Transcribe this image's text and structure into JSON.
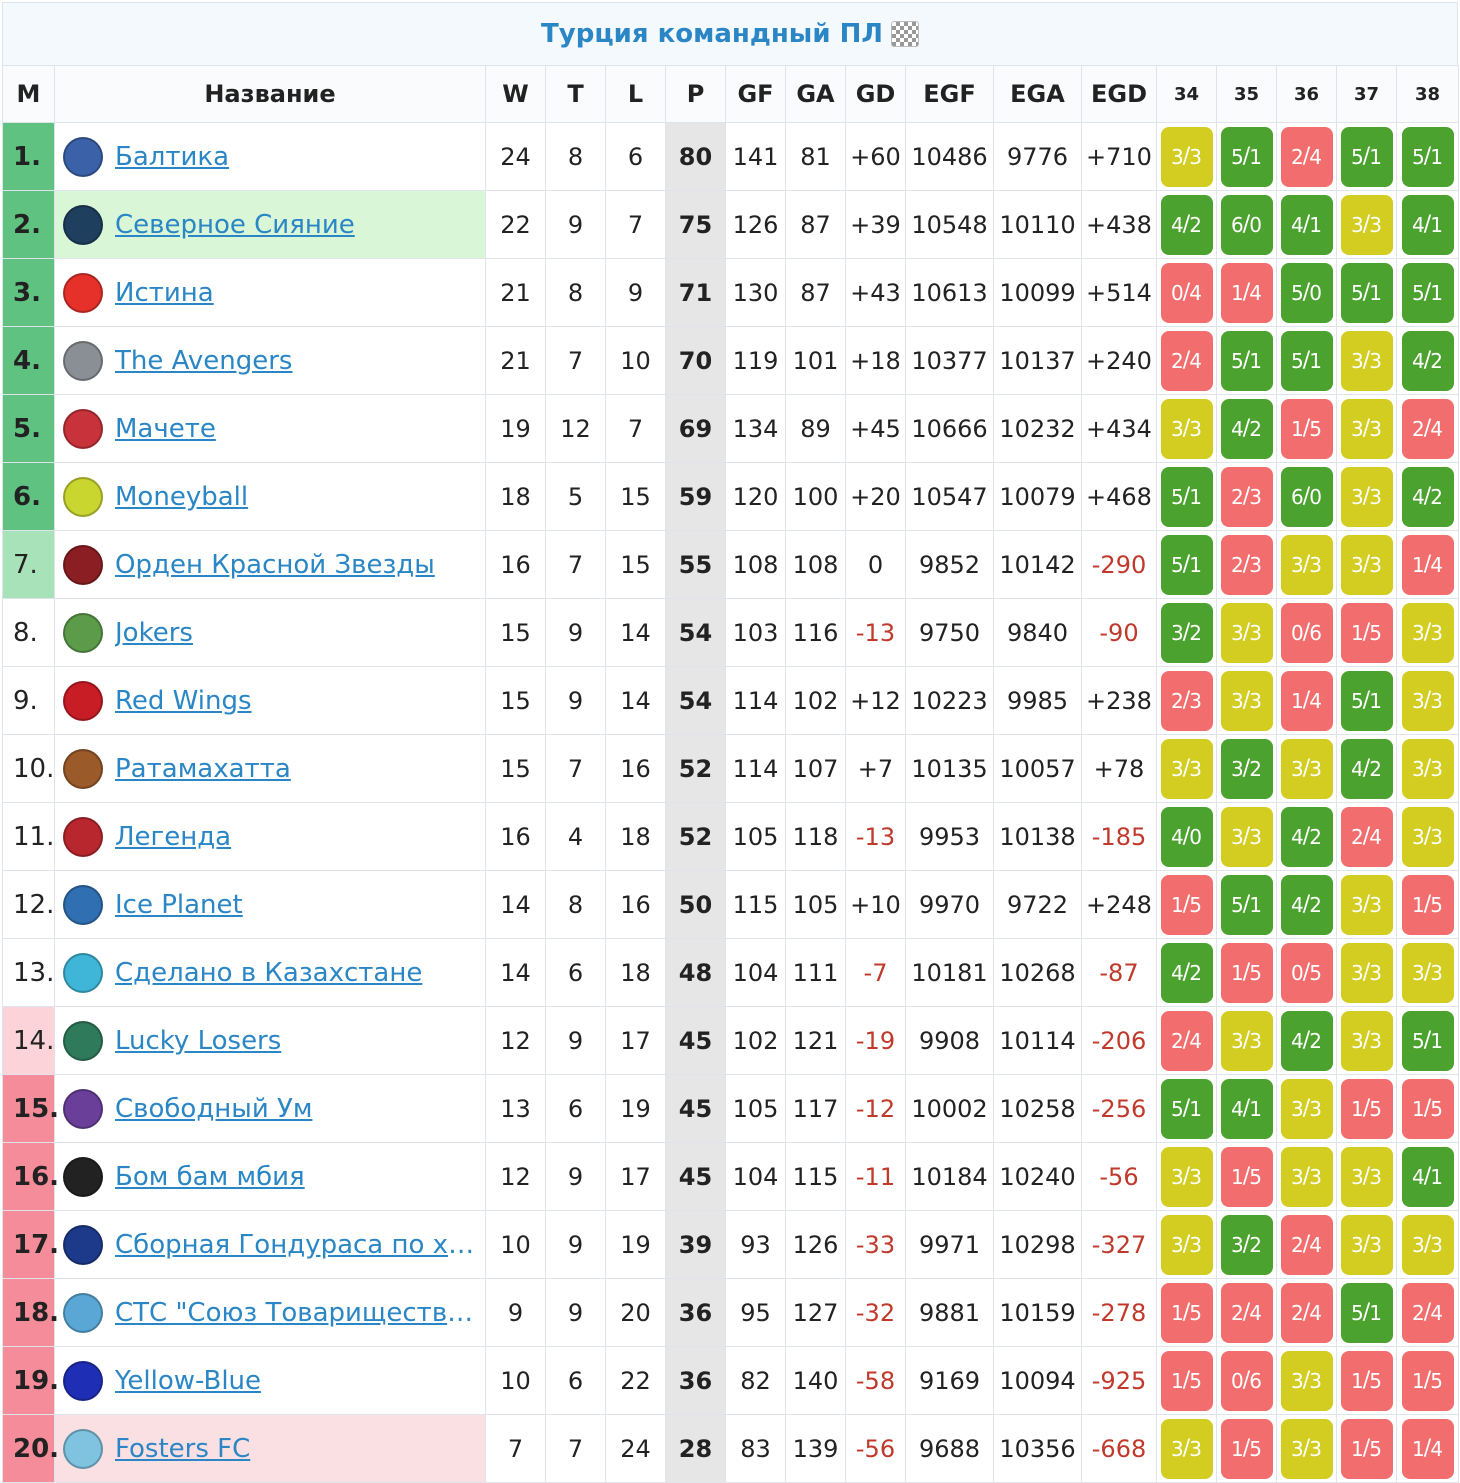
{
  "title": "Турция командный ПЛ",
  "headers": {
    "pos": "М",
    "name": "Название",
    "w": "W",
    "t": "T",
    "l": "L",
    "p": "P",
    "gf": "GF",
    "ga": "GA",
    "gd": "GD",
    "egf": "EGF",
    "ega": "EGA",
    "egd": "EGD",
    "rounds": [
      "34",
      "35",
      "36",
      "37",
      "38"
    ]
  },
  "rows": [
    {
      "pos": "1.",
      "name": "Балтика",
      "w": "24",
      "t": "8",
      "l": "6",
      "p": "80",
      "gf": "141",
      "ga": "81",
      "gd": "+60",
      "egf": "10486",
      "ega": "9776",
      "egd": "+710",
      "logo_color": "#3b62a8",
      "results": [
        [
          "3",
          "3"
        ],
        [
          "5",
          "1"
        ],
        [
          "2",
          "4"
        ],
        [
          "5",
          "1"
        ],
        [
          "5",
          "1"
        ]
      ]
    },
    {
      "pos": "2.",
      "name": "Северное Сияние",
      "w": "22",
      "t": "9",
      "l": "7",
      "p": "75",
      "gf": "126",
      "ga": "87",
      "gd": "+39",
      "egf": "10548",
      "ega": "10110",
      "egd": "+438",
      "logo_color": "#1f3f5e",
      "results": [
        [
          "4",
          "2"
        ],
        [
          "6",
          "0"
        ],
        [
          "4",
          "1"
        ],
        [
          "3",
          "3"
        ],
        [
          "4",
          "1"
        ]
      ]
    },
    {
      "pos": "3.",
      "name": "Истина",
      "w": "21",
      "t": "8",
      "l": "9",
      "p": "71",
      "gf": "130",
      "ga": "87",
      "gd": "+43",
      "egf": "10613",
      "ega": "10099",
      "egd": "+514",
      "logo_color": "#e5312a",
      "results": [
        [
          "0",
          "4"
        ],
        [
          "1",
          "4"
        ],
        [
          "5",
          "0"
        ],
        [
          "5",
          "1"
        ],
        [
          "5",
          "1"
        ]
      ]
    },
    {
      "pos": "4.",
      "name": "The Avengers",
      "w": "21",
      "t": "7",
      "l": "10",
      "p": "70",
      "gf": "119",
      "ga": "101",
      "gd": "+18",
      "egf": "10377",
      "ega": "10137",
      "egd": "+240",
      "logo_color": "#8a8f96",
      "results": [
        [
          "2",
          "4"
        ],
        [
          "5",
          "1"
        ],
        [
          "5",
          "1"
        ],
        [
          "3",
          "3"
        ],
        [
          "4",
          "2"
        ]
      ]
    },
    {
      "pos": "5.",
      "name": "Мачете",
      "w": "19",
      "t": "12",
      "l": "7",
      "p": "69",
      "gf": "134",
      "ga": "89",
      "gd": "+45",
      "egf": "10666",
      "ega": "10232",
      "egd": "+434",
      "logo_color": "#c8323a",
      "results": [
        [
          "3",
          "3"
        ],
        [
          "4",
          "2"
        ],
        [
          "1",
          "5"
        ],
        [
          "3",
          "3"
        ],
        [
          "2",
          "4"
        ]
      ]
    },
    {
      "pos": "6.",
      "name": "Moneyball",
      "w": "18",
      "t": "5",
      "l": "15",
      "p": "59",
      "gf": "120",
      "ga": "100",
      "gd": "+20",
      "egf": "10547",
      "ega": "10079",
      "egd": "+468",
      "logo_color": "#c9d630",
      "results": [
        [
          "5",
          "1"
        ],
        [
          "2",
          "3"
        ],
        [
          "6",
          "0"
        ],
        [
          "3",
          "3"
        ],
        [
          "4",
          "2"
        ]
      ]
    },
    {
      "pos": "7.",
      "name": "Орден Красной Звезды",
      "w": "16",
      "t": "7",
      "l": "15",
      "p": "55",
      "gf": "108",
      "ga": "108",
      "gd": "0",
      "egf": "9852",
      "ega": "10142",
      "egd": "-290",
      "logo_color": "#8b1e22",
      "results": [
        [
          "5",
          "1"
        ],
        [
          "2",
          "3"
        ],
        [
          "3",
          "3"
        ],
        [
          "3",
          "3"
        ],
        [
          "1",
          "4"
        ]
      ]
    },
    {
      "pos": "8.",
      "name": "Jokers",
      "w": "15",
      "t": "9",
      "l": "14",
      "p": "54",
      "gf": "103",
      "ga": "116",
      "gd": "-13",
      "egf": "9750",
      "ega": "9840",
      "egd": "-90",
      "logo_color": "#5b9b4a",
      "results": [
        [
          "3",
          "2"
        ],
        [
          "3",
          "3"
        ],
        [
          "0",
          "6"
        ],
        [
          "1",
          "5"
        ],
        [
          "3",
          "3"
        ]
      ]
    },
    {
      "pos": "9.",
      "name": "Red Wings",
      "w": "15",
      "t": "9",
      "l": "14",
      "p": "54",
      "gf": "114",
      "ga": "102",
      "gd": "+12",
      "egf": "10223",
      "ega": "9985",
      "egd": "+238",
      "logo_color": "#c81d25",
      "results": [
        [
          "2",
          "3"
        ],
        [
          "3",
          "3"
        ],
        [
          "1",
          "4"
        ],
        [
          "5",
          "1"
        ],
        [
          "3",
          "3"
        ]
      ]
    },
    {
      "pos": "10.",
      "name": "Ратамахатта",
      "w": "15",
      "t": "7",
      "l": "16",
      "p": "52",
      "gf": "114",
      "ga": "107",
      "gd": "+7",
      "egf": "10135",
      "ega": "10057",
      "egd": "+78",
      "logo_color": "#9a5a2a",
      "results": [
        [
          "3",
          "3"
        ],
        [
          "3",
          "2"
        ],
        [
          "3",
          "3"
        ],
        [
          "4",
          "2"
        ],
        [
          "3",
          "3"
        ]
      ]
    },
    {
      "pos": "11.",
      "name": "Легенда",
      "w": "16",
      "t": "4",
      "l": "18",
      "p": "52",
      "gf": "105",
      "ga": "118",
      "gd": "-13",
      "egf": "9953",
      "ega": "10138",
      "egd": "-185",
      "logo_color": "#b8272d",
      "results": [
        [
          "4",
          "0"
        ],
        [
          "3",
          "3"
        ],
        [
          "4",
          "2"
        ],
        [
          "2",
          "4"
        ],
        [
          "3",
          "3"
        ]
      ]
    },
    {
      "pos": "12.",
      "name": "Ice Planet",
      "w": "14",
      "t": "8",
      "l": "16",
      "p": "50",
      "gf": "115",
      "ga": "105",
      "gd": "+10",
      "egf": "9970",
      "ega": "9722",
      "egd": "+248",
      "logo_color": "#2f6fb2",
      "results": [
        [
          "1",
          "5"
        ],
        [
          "5",
          "1"
        ],
        [
          "4",
          "2"
        ],
        [
          "3",
          "3"
        ],
        [
          "1",
          "5"
        ]
      ]
    },
    {
      "pos": "13.",
      "name": "Сделано в Казахстане",
      "w": "14",
      "t": "6",
      "l": "18",
      "p": "48",
      "gf": "104",
      "ga": "111",
      "gd": "-7",
      "egf": "10181",
      "ega": "10268",
      "egd": "-87",
      "logo_color": "#3fb6d8",
      "results": [
        [
          "4",
          "2"
        ],
        [
          "1",
          "5"
        ],
        [
          "0",
          "5"
        ],
        [
          "3",
          "3"
        ],
        [
          "3",
          "3"
        ]
      ]
    },
    {
      "pos": "14.",
      "name": "Lucky Losers",
      "w": "12",
      "t": "9",
      "l": "17",
      "p": "45",
      "gf": "102",
      "ga": "121",
      "gd": "-19",
      "egf": "9908",
      "ega": "10114",
      "egd": "-206",
      "logo_color": "#2f7a5a",
      "results": [
        [
          "2",
          "4"
        ],
        [
          "3",
          "3"
        ],
        [
          "4",
          "2"
        ],
        [
          "3",
          "3"
        ],
        [
          "5",
          "1"
        ]
      ]
    },
    {
      "pos": "15.",
      "name": "Свободный Ум",
      "w": "13",
      "t": "6",
      "l": "19",
      "p": "45",
      "gf": "105",
      "ga": "117",
      "gd": "-12",
      "egf": "10002",
      "ega": "10258",
      "egd": "-256",
      "logo_color": "#6a3f9a",
      "results": [
        [
          "5",
          "1"
        ],
        [
          "4",
          "1"
        ],
        [
          "3",
          "3"
        ],
        [
          "1",
          "5"
        ],
        [
          "1",
          "5"
        ]
      ]
    },
    {
      "pos": "16.",
      "name": "Бом бам мбия",
      "w": "12",
      "t": "9",
      "l": "17",
      "p": "45",
      "gf": "104",
      "ga": "115",
      "gd": "-11",
      "egf": "10184",
      "ega": "10240",
      "egd": "-56",
      "logo_color": "#222222",
      "results": [
        [
          "3",
          "3"
        ],
        [
          "1",
          "5"
        ],
        [
          "3",
          "3"
        ],
        [
          "3",
          "3"
        ],
        [
          "4",
          "1"
        ]
      ]
    },
    {
      "pos": "17.",
      "name": "Сборная Гондураса по хоккею",
      "w": "10",
      "t": "9",
      "l": "19",
      "p": "39",
      "gf": "93",
      "ga": "126",
      "gd": "-33",
      "egf": "9971",
      "ega": "10298",
      "egd": "-327",
      "logo_color": "#1d3a8a",
      "results": [
        [
          "3",
          "3"
        ],
        [
          "3",
          "2"
        ],
        [
          "2",
          "4"
        ],
        [
          "3",
          "3"
        ],
        [
          "3",
          "3"
        ]
      ]
    },
    {
      "pos": "18.",
      "name": "СТС \"Союз Товарищества Спорта\"",
      "w": "9",
      "t": "9",
      "l": "20",
      "p": "36",
      "gf": "95",
      "ga": "127",
      "gd": "-32",
      "egf": "9881",
      "ega": "10159",
      "egd": "-278",
      "logo_color": "#5aa7d6",
      "results": [
        [
          "1",
          "5"
        ],
        [
          "2",
          "4"
        ],
        [
          "2",
          "4"
        ],
        [
          "5",
          "1"
        ],
        [
          "2",
          "4"
        ]
      ]
    },
    {
      "pos": "19.",
      "name": "Yellow-Blue",
      "w": "10",
      "t": "6",
      "l": "22",
      "p": "36",
      "gf": "82",
      "ga": "140",
      "gd": "-58",
      "egf": "9169",
      "ega": "10094",
      "egd": "-925",
      "logo_color": "#1f2fb5",
      "results": [
        [
          "1",
          "5"
        ],
        [
          "0",
          "6"
        ],
        [
          "3",
          "3"
        ],
        [
          "1",
          "5"
        ],
        [
          "1",
          "5"
        ]
      ]
    },
    {
      "pos": "20.",
      "name": "Fosters FC",
      "w": "7",
      "t": "7",
      "l": "24",
      "p": "28",
      "gf": "83",
      "ga": "139",
      "gd": "-56",
      "egf": "9688",
      "ega": "10356",
      "egd": "-668",
      "logo_color": "#7fc3e0",
      "results": [
        [
          "3",
          "3"
        ],
        [
          "1",
          "5"
        ],
        [
          "3",
          "3"
        ],
        [
          "1",
          "5"
        ],
        [
          "1",
          "4"
        ]
      ]
    }
  ]
}
